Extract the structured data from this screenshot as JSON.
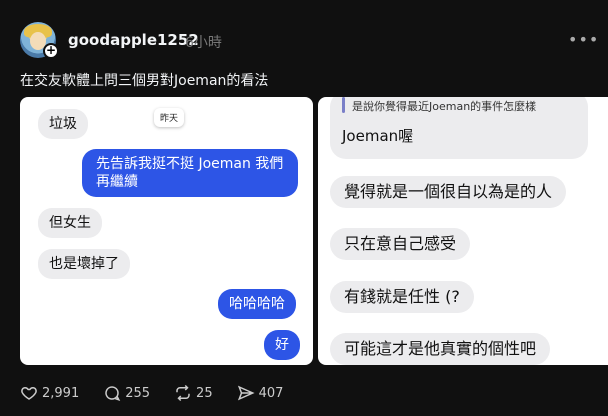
{
  "post": {
    "username": "goodapple1252",
    "time_ago": "6小時",
    "more_icon": "more-horizontal-icon",
    "caption": "在交友軟體上問三個男對Joeman的看法"
  },
  "left_chat": {
    "date_label": "昨天",
    "messages": [
      {
        "text": "垃圾",
        "side": "left"
      },
      {
        "text": "先告訴我挺不挺 Joeman 我們再繼續",
        "side": "right"
      },
      {
        "text": "但女生",
        "side": "left"
      },
      {
        "text": "也是壞掉了",
        "side": "left"
      },
      {
        "text": "哈哈哈哈",
        "side": "right"
      },
      {
        "text": "好",
        "side": "right"
      }
    ]
  },
  "right_chat": {
    "quote": "是說你覺得最近Joeman的事件怎麼樣",
    "reply": "Joeman喔",
    "messages": [
      {
        "text": "覺得就是一個很自以為是的人"
      },
      {
        "text": "只在意自己感受"
      },
      {
        "text": "有錢就是任性 (?"
      },
      {
        "text": "可能這才是他真實的個性吧"
      }
    ]
  },
  "actions": {
    "likes": "2,991",
    "comments": "255",
    "reposts": "25",
    "shares": "407"
  },
  "colors": {
    "background": "#101010",
    "bubble_blue": "#2d55e6",
    "bubble_gray": "#ececee"
  }
}
